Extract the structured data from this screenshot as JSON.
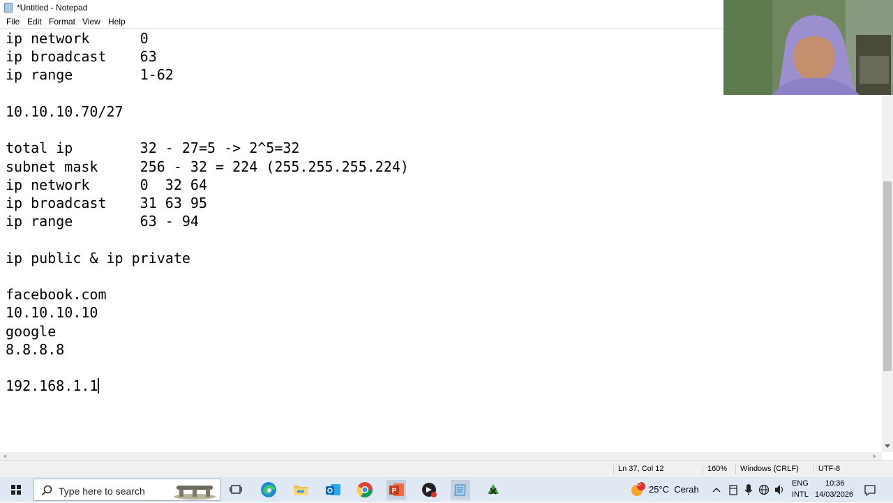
{
  "window": {
    "title": "*Untitled - Notepad"
  },
  "menu": [
    {
      "label": "File"
    },
    {
      "label": "Edit"
    },
    {
      "label": "Format"
    },
    {
      "label": "View"
    },
    {
      "label": "Help"
    }
  ],
  "editor": {
    "lines": [
      "ip network      0",
      "ip broadcast    63",
      "ip range        1-62",
      "",
      "10.10.10.70/27",
      "",
      "total ip        32 - 27=5 -> 2^5=32",
      "subnet mask     256 - 32 = 224 (255.255.255.224)",
      "ip network      0  32 64",
      "ip broadcast    31 63 95",
      "ip range        63 - 94",
      "",
      "ip public & ip private",
      "",
      "facebook.com",
      "10.10.10.10",
      "google",
      "8.8.8.8",
      "",
      "192.168.1.1"
    ]
  },
  "statusbar": {
    "position": "Ln 37, Col 12",
    "zoom": "160%",
    "line_ending": "Windows (CRLF)",
    "encoding": "UTF-8"
  },
  "taskbar": {
    "search_placeholder": "Type here to search",
    "apps": [
      {
        "icon": "task-view-icon"
      },
      {
        "icon": "edge-icon"
      },
      {
        "icon": "file-explorer-icon"
      },
      {
        "icon": "outlook-icon"
      },
      {
        "icon": "chrome-icon"
      },
      {
        "icon": "powerpoint-icon"
      },
      {
        "icon": "recorder-icon"
      },
      {
        "icon": "notepad-icon"
      },
      {
        "icon": "app-icon"
      }
    ],
    "weather": {
      "badge": "5",
      "text": "25°C  Cerah"
    },
    "language": {
      "line1": "ENG",
      "line2": "INTL"
    },
    "clock": {
      "time": "10:36",
      "date": "14/03/2026"
    }
  },
  "colors": {
    "taskbar_bg": "#dfe8f3",
    "statusbar_bg": "#f0f0f0",
    "webcam_wall": "#7a8d6a",
    "hijab": "#9b8fd0"
  }
}
